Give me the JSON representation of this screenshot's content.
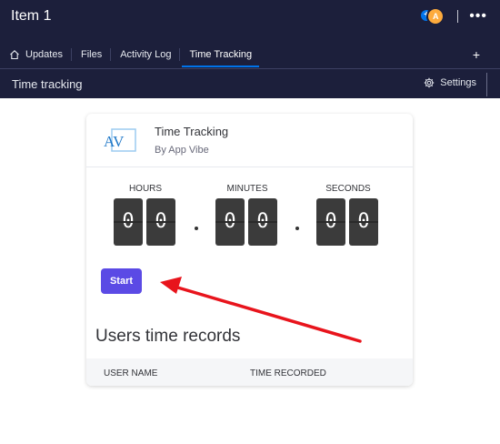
{
  "header": {
    "item_title": "Item 1",
    "avatar_initial": "A",
    "plus_badge": "+",
    "more": "•••"
  },
  "tabs": [
    {
      "label": "Updates",
      "icon": "home-icon"
    },
    {
      "label": "Files"
    },
    {
      "label": "Activity Log"
    },
    {
      "label": "Time Tracking",
      "active": true
    }
  ],
  "add_tab": "+",
  "section": {
    "title": "Time tracking",
    "settings_label": "Settings",
    "settings_icon": "gear-icon"
  },
  "card": {
    "logo_text": "AV",
    "app_name": "Time Tracking",
    "app_by": "By App Vibe",
    "timer": {
      "hours_label": "HOURS",
      "minutes_label": "MINUTES",
      "seconds_label": "SECONDS",
      "h1": "0",
      "h2": "0",
      "m1": "0",
      "m2": "0",
      "s1": "0",
      "s2": "0"
    },
    "start_label": "Start",
    "records_title": "Users time records",
    "columns": [
      "USER NAME",
      "TIME RECORDED"
    ]
  },
  "colors": {
    "topbar": "#1c1f3b",
    "accent": "#0073ea",
    "start_button": "#5b4ae5",
    "arrow": "#e8141c"
  }
}
